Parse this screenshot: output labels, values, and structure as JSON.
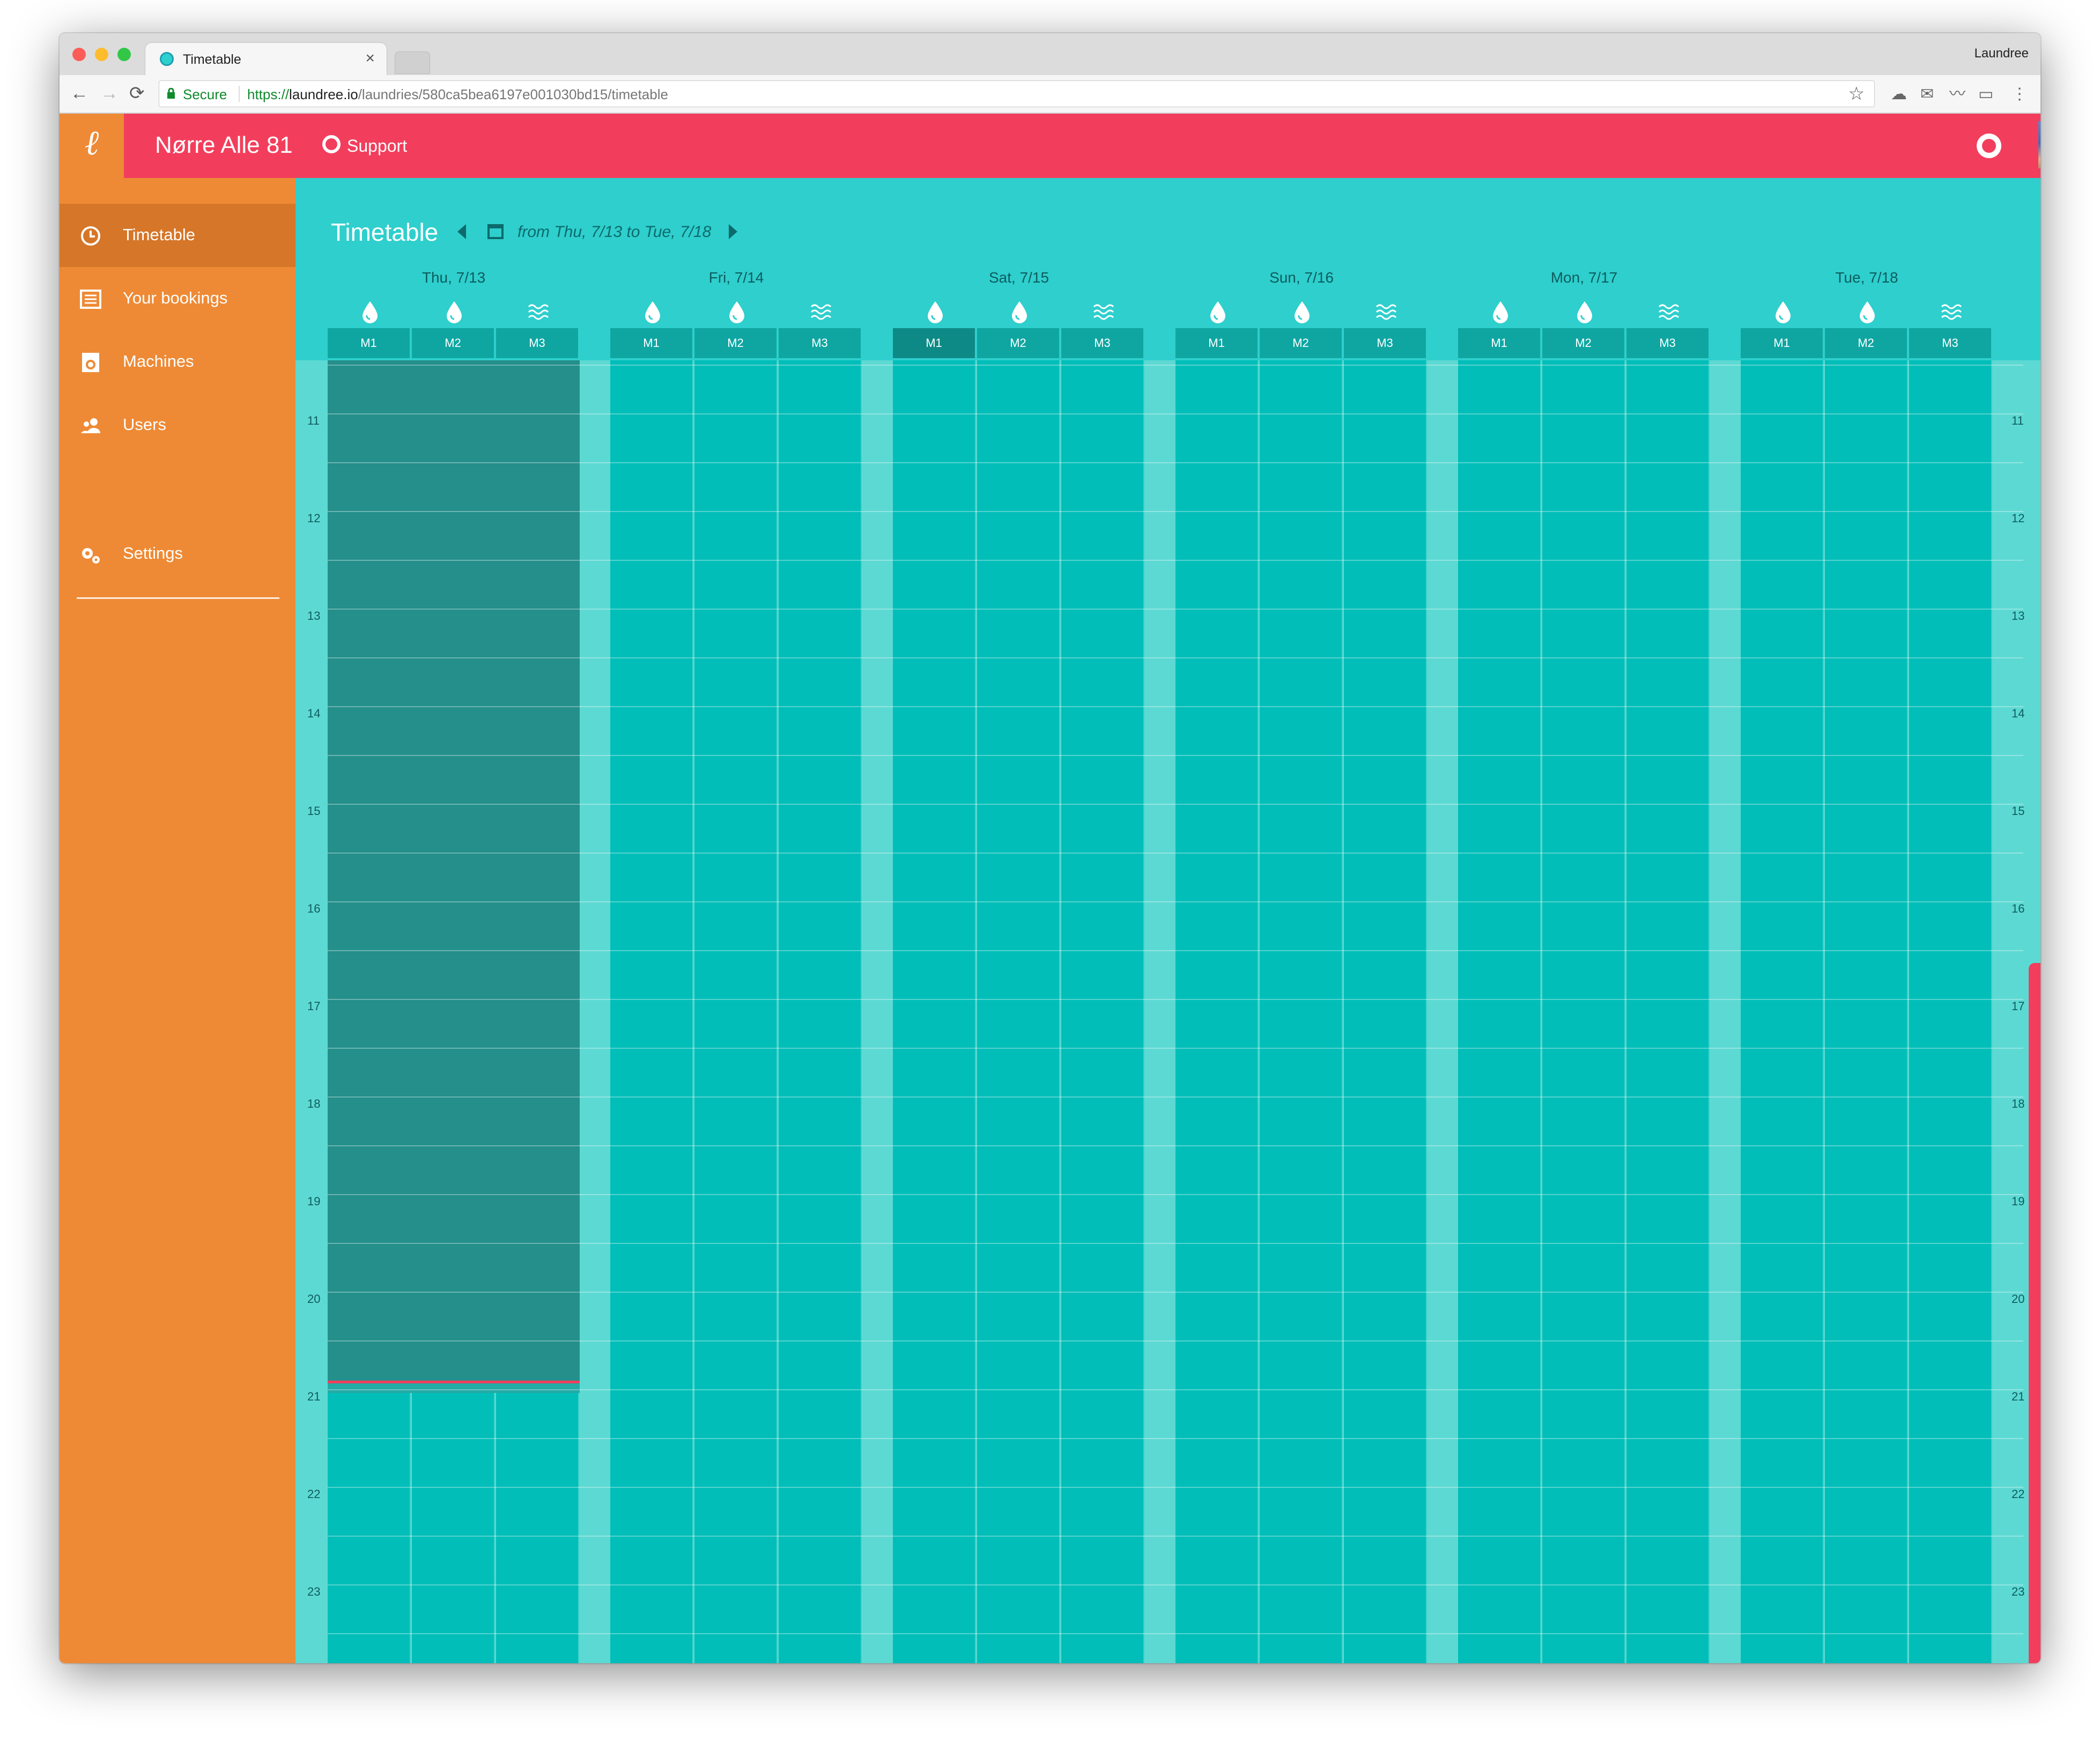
{
  "browser": {
    "tab_title": "Timetable",
    "tab_close": "×",
    "profile_name": "Laundree",
    "secure_label": "Secure",
    "url_scheme": "https://",
    "url_host": "laundree.io",
    "url_path": "/laundries/580ca5bea6197e001030bd15/timetable",
    "nav_back": "←",
    "nav_forward": "→",
    "nav_reload": "⟳",
    "bookmark_star": "☆"
  },
  "app": {
    "logo": "ℓ",
    "laundry_name": "Nørre Alle 81",
    "support_label": "Support",
    "sidebar": {
      "items": [
        {
          "label": "Timetable",
          "icon": "clock-icon",
          "active": true
        },
        {
          "label": "Your bookings",
          "icon": "list-icon",
          "active": false
        },
        {
          "label": "Machines",
          "icon": "washing-machine-icon",
          "active": false
        },
        {
          "label": "Users",
          "icon": "users-icon",
          "active": false
        },
        {
          "label": "Settings",
          "icon": "gears-icon",
          "active": false
        }
      ]
    },
    "timetable": {
      "title": "Timetable",
      "range_text": "from Thu, 7/13 to Tue, 7/18",
      "days": [
        "Thu, 7/13",
        "Fri, 7/14",
        "Sat, 7/15",
        "Sun, 7/16",
        "Mon, 7/17",
        "Tue, 7/18"
      ],
      "machines": [
        {
          "name": "M1",
          "type": "washer"
        },
        {
          "name": "M2",
          "type": "washer"
        },
        {
          "name": "M3",
          "type": "dryer"
        }
      ],
      "hours": [
        "11",
        "12",
        "13",
        "14",
        "15",
        "16",
        "17",
        "18",
        "19",
        "20",
        "21",
        "22",
        "23"
      ]
    },
    "colors": {
      "topbar": "#f23e5c",
      "sidebar": "#ee8a35",
      "main": "#2ecfcd",
      "slot": "#02beb8",
      "past": "#248f8b"
    }
  }
}
